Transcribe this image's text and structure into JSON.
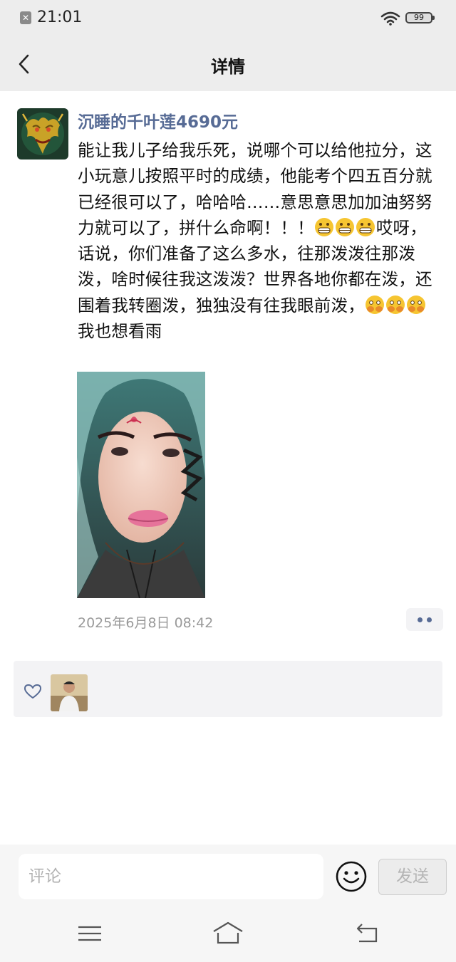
{
  "status_bar": {
    "time": "21:01",
    "battery": "99",
    "notification_icon": "close-notification-icon",
    "wifi_icon": "wifi-icon"
  },
  "header": {
    "title": "详情",
    "back_icon": "chevron-left-icon"
  },
  "post": {
    "username": "沉睡的千叶莲4690元",
    "avatar_icon": "golden-dragon-avatar",
    "text_1": "能让我儿子给我乐死，说哪个可以给他拉分，这小玩意儿按照平时的成绩，他能考个四五百分就已经很可以了，哈哈哈……意思意思加加油努努力就可以了，拼什么命啊！！！",
    "emoji_1": "grimace-emoji",
    "text_2": "哎呀，话说，你们准备了这么多水，往那泼泼往那泼泼，啥时候往我这泼泼？世界各地你都在泼，还围着我转圈泼，独独没有往我眼前泼，",
    "emoji_2": "peek-emoji",
    "text_3": "我也想看雨",
    "image": "selfie-photo",
    "timestamp": "2025年6月8日 08:42",
    "more_icon": "more-dots-icon"
  },
  "likes": {
    "heart_icon": "heart-outline-icon",
    "likers": [
      "liker-avatar"
    ]
  },
  "comment_bar": {
    "placeholder": "评论",
    "emoji_icon": "smiley-icon",
    "send_label": "发送"
  },
  "nav_bar": {
    "menu_icon": "menu-icon",
    "home_icon": "home-icon",
    "back_icon": "back-arrow-icon"
  },
  "colors": {
    "link_blue": "#576b95",
    "header_bg": "#ededed",
    "panel_bg": "#f3f3f5"
  }
}
